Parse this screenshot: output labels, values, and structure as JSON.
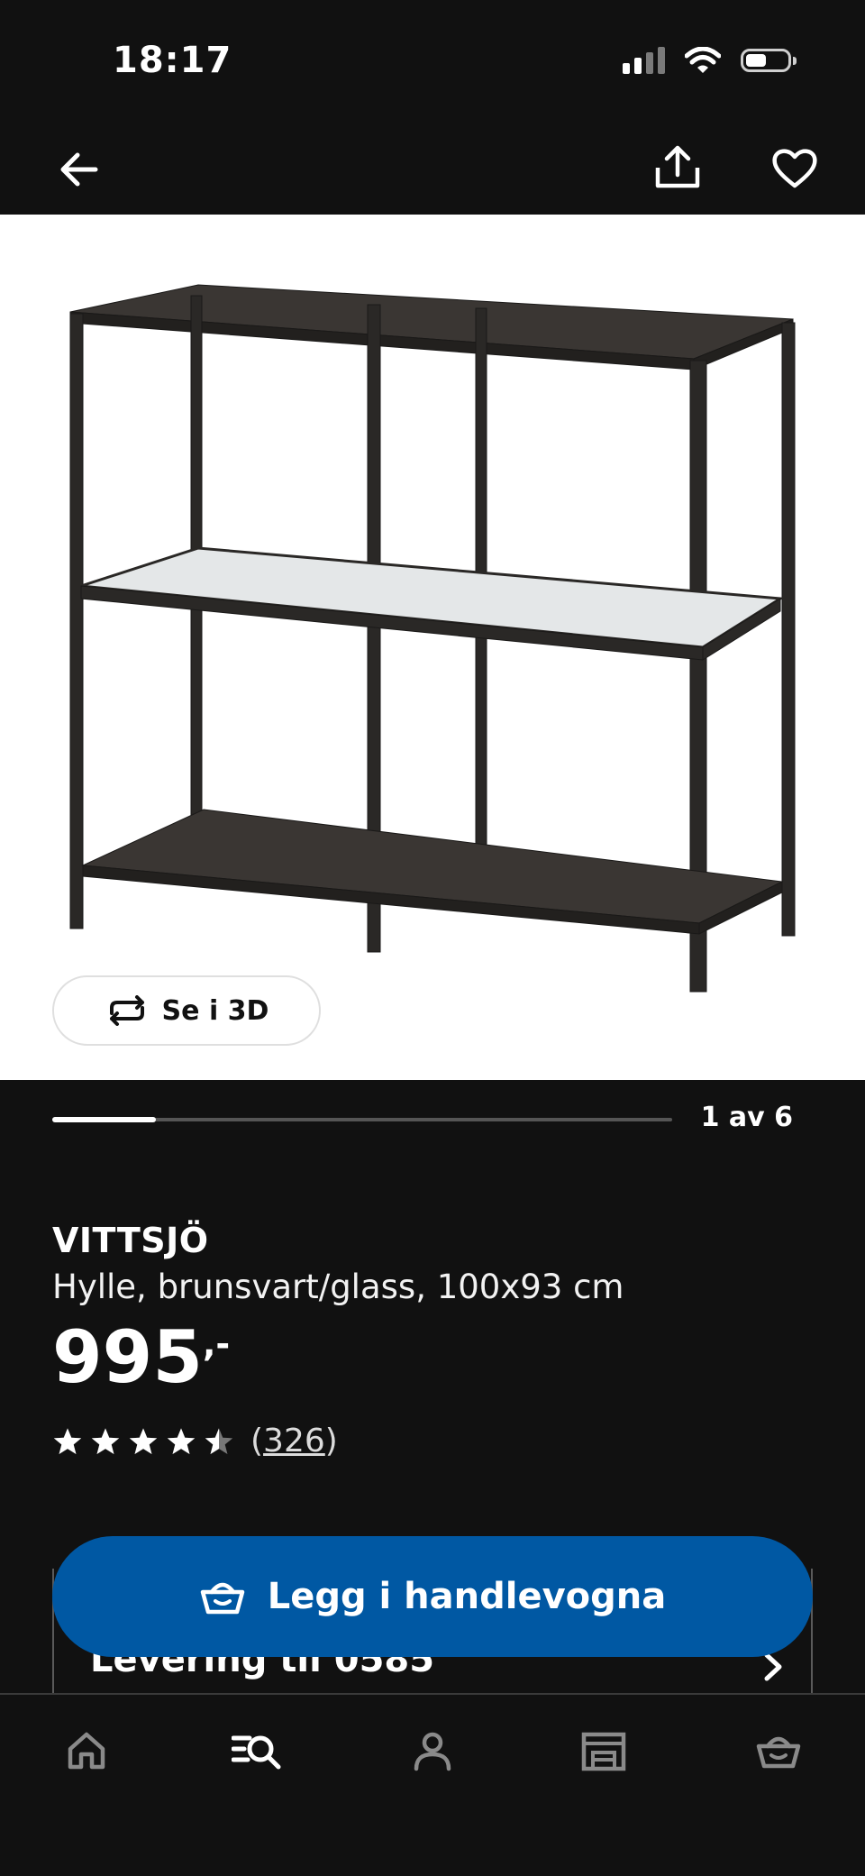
{
  "status_bar": {
    "time": "18:17"
  },
  "top_nav": {
    "back_icon": "arrow-left-icon",
    "share_icon": "share-icon",
    "favorite_icon": "heart-icon"
  },
  "gallery": {
    "view_3d_label": "Se i 3D",
    "view_3d_icon": "rotate-icon",
    "pager_label": "1 av 6",
    "current_image": 1,
    "total_images": 6
  },
  "product": {
    "name": "VITTSJÖ",
    "description": "Hylle, brunsvart/glass, 100x93 cm",
    "price_main": "995",
    "price_decimals": ",-",
    "rating": 4.5,
    "rating_max": 5,
    "review_count": "326",
    "review_open": "(",
    "review_close": ")"
  },
  "delivery": {
    "label": "Levering til 0585"
  },
  "cta": {
    "label": "Legg i handlevogna",
    "icon": "basket-icon",
    "color": "#0058a3"
  },
  "tabbar": {
    "items": [
      {
        "icon": "home-icon",
        "active": false
      },
      {
        "icon": "search-menu-icon",
        "active": true
      },
      {
        "icon": "profile-icon",
        "active": false
      },
      {
        "icon": "store-icon",
        "active": false
      },
      {
        "icon": "basket-icon",
        "active": false
      }
    ]
  }
}
